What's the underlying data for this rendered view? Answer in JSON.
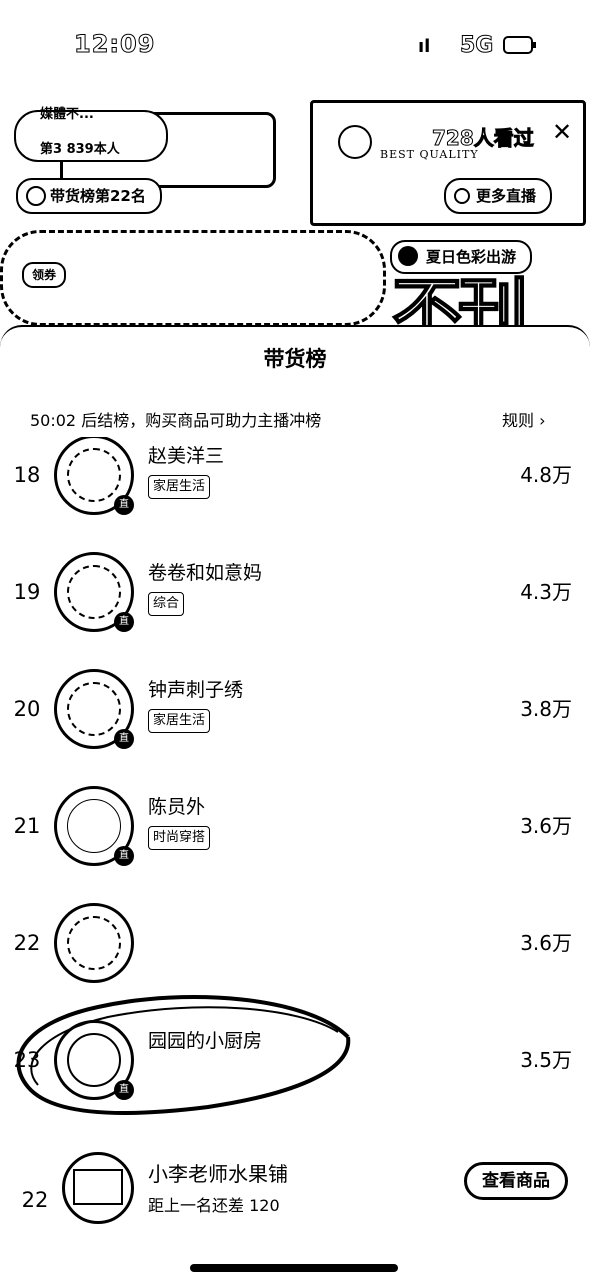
{
  "status_bar": {
    "time": "12:09",
    "signal": "ıl",
    "network": "5G"
  },
  "live": {
    "streamer_name": "媒體不...",
    "streamer_fans": "第3 839本人",
    "viewer_count": "728人看过",
    "rank_pill": "带货榜第22名",
    "more_live": "更多直播",
    "promo_tag": "夏日色彩出游",
    "mini_badge": "领券",
    "big_text": "不刊",
    "brand_text": "BEST QUALITY"
  },
  "sheet": {
    "title": "带货榜",
    "countdown": "50:02 后结榜，购买商品可助力主播冲榜",
    "rules_label": "规则 ›"
  },
  "ranking": [
    {
      "rank": "18",
      "name": "赵美洋三",
      "tag": "家居生活",
      "score": "4.8万"
    },
    {
      "rank": "19",
      "name": "卷卷和如意妈",
      "tag": "综合",
      "score": "4.3万"
    },
    {
      "rank": "20",
      "name": "钟声刺子绣",
      "tag": "家居生活",
      "score": "3.8万"
    },
    {
      "rank": "21",
      "name": "陈员外",
      "tag": "时尚穿搭",
      "score": "3.6万"
    },
    {
      "rank": "22",
      "name": "",
      "tag": "",
      "score": "3.6万"
    },
    {
      "rank": "23",
      "name": "园园的小厨房",
      "tag": "",
      "score": "3.5万"
    }
  ],
  "my_entry": {
    "rank": "22",
    "name": "小李老师水果铺",
    "gap": "距上一名还差 120",
    "button_label": "查看商品"
  }
}
